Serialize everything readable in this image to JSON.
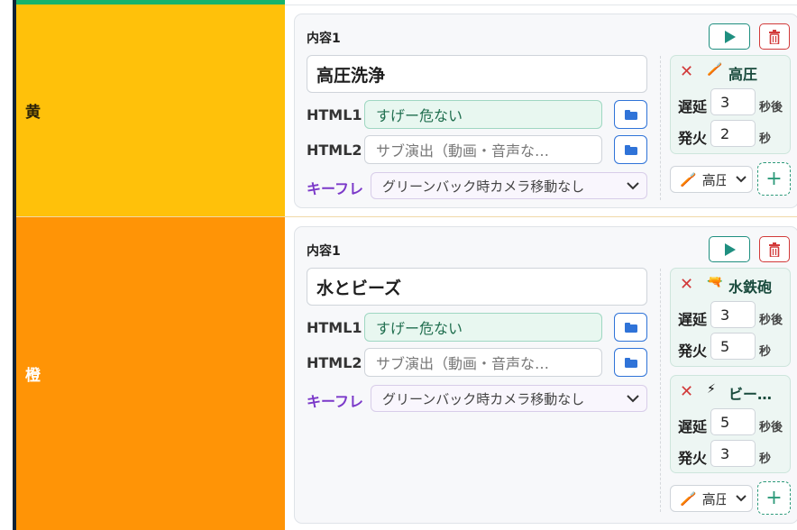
{
  "colors": {
    "yellow_band": "#ffc10a",
    "orange_band": "#ff9406",
    "accent_green": "#1f8f80",
    "danger_red": "#d23a3a",
    "blue": "#2f73d8",
    "purple": "#7b39c9"
  },
  "rows": [
    {
      "band_label": "黄",
      "card": {
        "title": "内容1",
        "main_text": "高圧洗浄",
        "html1_label": "HTML1",
        "html1_value": "すげー危ない",
        "html2_label": "HTML2",
        "html2_placeholder": "サブ演出（動画・音声な…",
        "keyframe_label": "キーフレ",
        "keyframe_value": "グリーンバック時カメラ移動なし",
        "effects": [
          {
            "icon": "pressure-washer-icon",
            "name": "高圧",
            "delay_label": "遅延",
            "delay": "3",
            "delay_unit": "秒後",
            "fire_label": "発火",
            "fire": "2",
            "fire_unit": "秒"
          }
        ],
        "add_select": "高圧"
      }
    },
    {
      "band_label": "橙",
      "card": {
        "title": "内容1",
        "main_text": "水とビーズ",
        "html1_label": "HTML1",
        "html1_value": "すげー危ない",
        "html2_label": "HTML2",
        "html2_placeholder": "サブ演出（動画・音声な…",
        "keyframe_label": "キーフレ",
        "keyframe_value": "グリーンバック時カメラ移動なし",
        "effects": [
          {
            "icon": "water-gun-icon",
            "name": "水鉄砲",
            "delay_label": "遅延",
            "delay": "3",
            "delay_unit": "秒後",
            "fire_label": "発火",
            "fire": "5",
            "fire_unit": "秒"
          },
          {
            "icon": "lightning-icon",
            "name": "ビー…",
            "delay_label": "遅延",
            "delay": "5",
            "delay_unit": "秒後",
            "fire_label": "発火",
            "fire": "3",
            "fire_unit": "秒"
          }
        ],
        "add_select": "高圧"
      }
    }
  ]
}
